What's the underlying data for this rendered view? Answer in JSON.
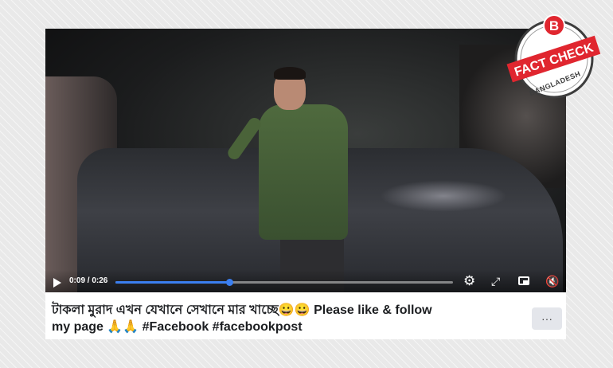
{
  "video": {
    "time": "0:09 / 0:26",
    "progress_fraction": 0.337,
    "icons": [
      "play-icon",
      "gear-icon",
      "expand-icon",
      "pip-icon",
      "volume-icon"
    ]
  },
  "post": {
    "caption_line1": "টাকলা মুরাদ এখন যেখানে সেখানে মার খাচ্ছে😀😀 Please like & follow",
    "caption_line2": "my page 🙏🙏 #Facebook #facebookpost",
    "more_label": "···"
  },
  "badge": {
    "letter": "B",
    "top_text": "FACT CHECK",
    "bottom_text": "BANGLADESH",
    "accent_color": "#e0262f"
  },
  "colors": {
    "progress": "#3b7ff0",
    "background": "#e9e9e9"
  }
}
